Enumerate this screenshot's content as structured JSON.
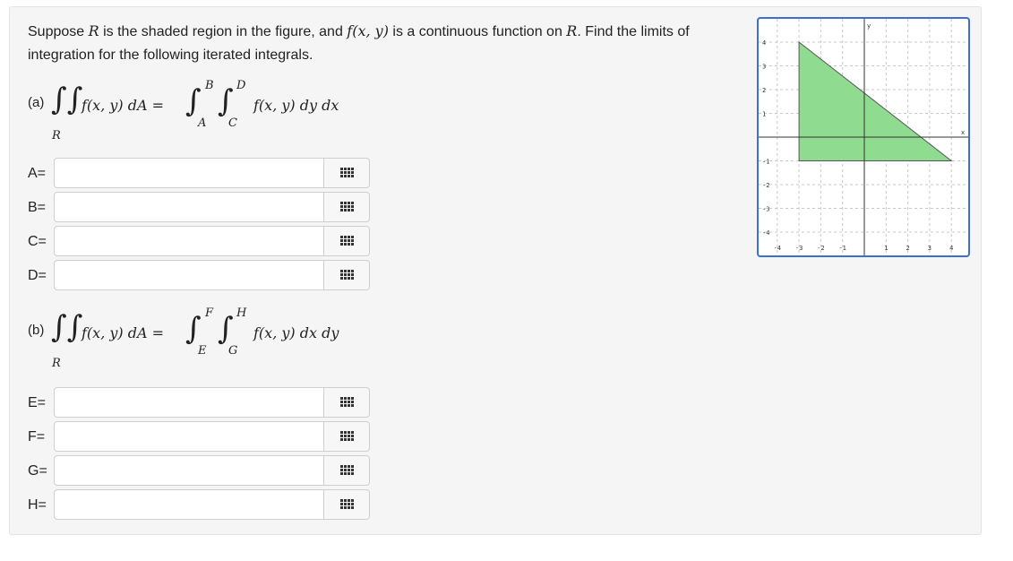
{
  "question": {
    "text_before": "Suppose ",
    "region_var": "R",
    "text_mid1": " is the shaded region in the figure, and ",
    "func": "f(x, y)",
    "text_mid2": " is a continuous function on ",
    "region_var2": "R",
    "text_end": ". Find the limits of integration for the following iterated integrals."
  },
  "part_a": {
    "label": "(a)",
    "integrand": "f(x, y) dA =",
    "region": "R",
    "outer_upper": "B",
    "outer_lower": "A",
    "inner_upper": "D",
    "inner_lower": "C",
    "inner_integrand": "f(x, y) dy dx",
    "inputs": [
      {
        "label": "A=",
        "value": ""
      },
      {
        "label": "B=",
        "value": ""
      },
      {
        "label": "C=",
        "value": ""
      },
      {
        "label": "D=",
        "value": ""
      }
    ]
  },
  "part_b": {
    "label": "(b)",
    "integrand": "f(x, y) dA =",
    "region": "R",
    "outer_upper": "F",
    "outer_lower": "E",
    "inner_upper": "H",
    "inner_lower": "G",
    "inner_integrand": "f(x, y) dx dy",
    "inputs": [
      {
        "label": "E=",
        "value": ""
      },
      {
        "label": "F=",
        "value": ""
      },
      {
        "label": "G=",
        "value": ""
      },
      {
        "label": "H=",
        "value": ""
      }
    ]
  },
  "icons": {
    "matrix_button": "grid-icon"
  },
  "graph": {
    "x_axis_label": "x",
    "y_axis_label": "y",
    "x_ticks": [
      "-4",
      "-3",
      "-2",
      "-1",
      "1",
      "2",
      "3",
      "4"
    ],
    "y_ticks": [
      "4",
      "3",
      "2",
      "1",
      "-1",
      "-2",
      "-3",
      "-4"
    ],
    "x_range": [
      -5,
      5
    ],
    "y_range": [
      -5,
      5
    ],
    "shaded_triangle": [
      [
        -3,
        4
      ],
      [
        -3,
        -1
      ],
      [
        4,
        -1
      ]
    ],
    "fill_color": "#8fdb8f",
    "border_color": "#3a6fd8"
  }
}
